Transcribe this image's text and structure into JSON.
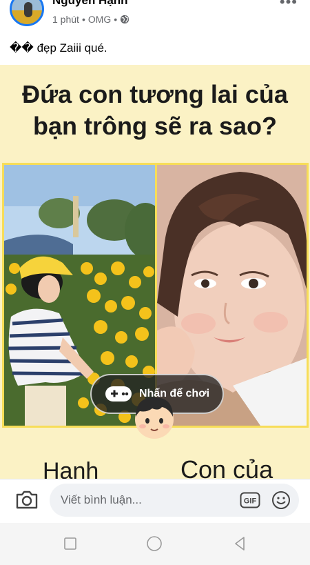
{
  "post": {
    "author": "Nguyen Hạnh",
    "time": "1 phút",
    "location": "OMG",
    "text": "�� đẹp Zaiii qué."
  },
  "image": {
    "headline_line1": "Đứa con tương lai của",
    "headline_line2": "bạn trông sẽ ra sao?",
    "play_label": "Nhấn để chơi",
    "label_left": "Hạnh",
    "label_right": "Con của"
  },
  "comment_bar": {
    "placeholder": "Viết bình luận...",
    "gif_label": "GIF"
  },
  "colors": {
    "background_yellow": "#fbf2c5",
    "frame_yellow": "#f7dd58",
    "facebook_blue": "#1877f2",
    "meta_gray": "#65676b"
  },
  "icons": [
    "globe-icon",
    "more-icon",
    "gamepad-icon",
    "camera-icon",
    "gif-icon",
    "smiley-icon",
    "square-nav-icon",
    "circle-nav-icon",
    "triangle-nav-icon"
  ]
}
